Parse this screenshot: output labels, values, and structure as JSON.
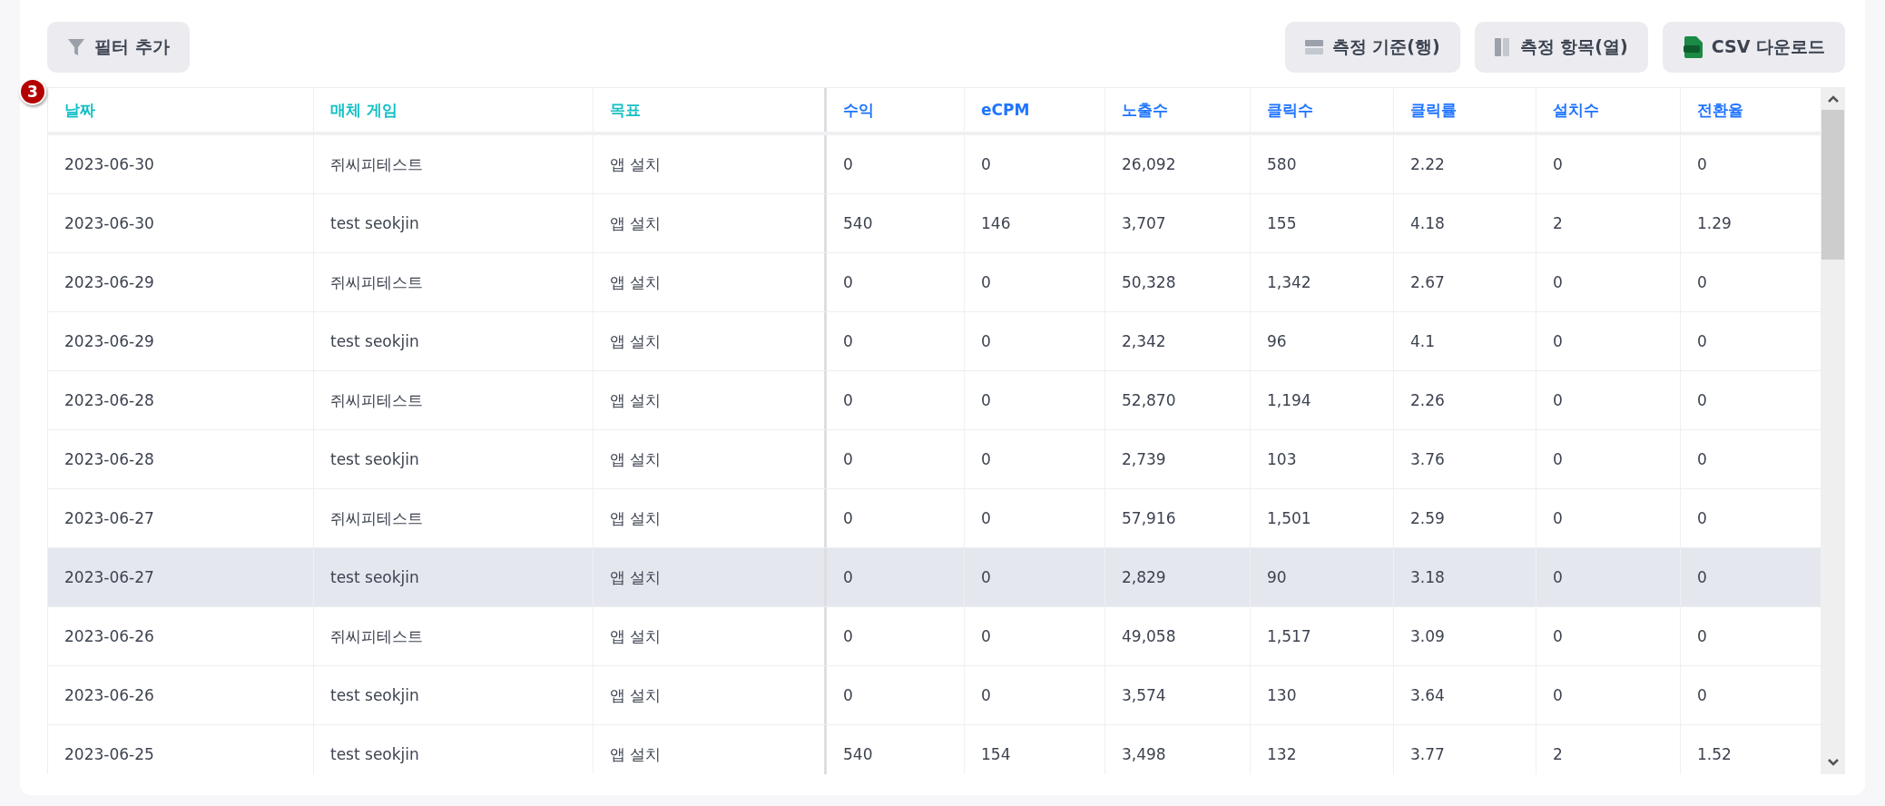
{
  "toolbar": {
    "filter_button": "필터 추가",
    "buttons": [
      {
        "kind": "rows",
        "label": "측정 기준(행)"
      },
      {
        "kind": "columns",
        "label": "측정 항목(열)"
      },
      {
        "kind": "csv",
        "label": "CSV 다운로드"
      }
    ]
  },
  "step_badge": "3",
  "table": {
    "columns": [
      {
        "label": "날짜",
        "kind": "dimension"
      },
      {
        "label": "매체 게임",
        "kind": "dimension"
      },
      {
        "label": "목표",
        "kind": "dimension"
      },
      {
        "label": "수익",
        "kind": "metric"
      },
      {
        "label": "eCPM",
        "kind": "metric"
      },
      {
        "label": "노출수",
        "kind": "metric"
      },
      {
        "label": "클릭수",
        "kind": "metric"
      },
      {
        "label": "클릭률",
        "kind": "metric"
      },
      {
        "label": "설치수",
        "kind": "metric"
      },
      {
        "label": "전환율",
        "kind": "metric"
      }
    ],
    "rows": [
      {
        "selected": false,
        "cells": [
          "2023-06-30",
          "쥐씨피테스트",
          "앱 설치",
          "0",
          "0",
          "26,092",
          "580",
          "2.22",
          "0",
          "0"
        ]
      },
      {
        "selected": false,
        "cells": [
          "2023-06-30",
          "test seokjin",
          "앱 설치",
          "540",
          "146",
          "3,707",
          "155",
          "4.18",
          "2",
          "1.29"
        ]
      },
      {
        "selected": false,
        "cells": [
          "2023-06-29",
          "쥐씨피테스트",
          "앱 설치",
          "0",
          "0",
          "50,328",
          "1,342",
          "2.67",
          "0",
          "0"
        ]
      },
      {
        "selected": false,
        "cells": [
          "2023-06-29",
          "test seokjin",
          "앱 설치",
          "0",
          "0",
          "2,342",
          "96",
          "4.1",
          "0",
          "0"
        ]
      },
      {
        "selected": false,
        "cells": [
          "2023-06-28",
          "쥐씨피테스트",
          "앱 설치",
          "0",
          "0",
          "52,870",
          "1,194",
          "2.26",
          "0",
          "0"
        ]
      },
      {
        "selected": false,
        "cells": [
          "2023-06-28",
          "test seokjin",
          "앱 설치",
          "0",
          "0",
          "2,739",
          "103",
          "3.76",
          "0",
          "0"
        ]
      },
      {
        "selected": false,
        "cells": [
          "2023-06-27",
          "쥐씨피테스트",
          "앱 설치",
          "0",
          "0",
          "57,916",
          "1,501",
          "2.59",
          "0",
          "0"
        ]
      },
      {
        "selected": true,
        "cells": [
          "2023-06-27",
          "test seokjin",
          "앱 설치",
          "0",
          "0",
          "2,829",
          "90",
          "3.18",
          "0",
          "0"
        ]
      },
      {
        "selected": false,
        "cells": [
          "2023-06-26",
          "쥐씨피테스트",
          "앱 설치",
          "0",
          "0",
          "49,058",
          "1,517",
          "3.09",
          "0",
          "0"
        ]
      },
      {
        "selected": false,
        "cells": [
          "2023-06-26",
          "test seokjin",
          "앱 설치",
          "0",
          "0",
          "3,574",
          "130",
          "3.64",
          "0",
          "0"
        ]
      },
      {
        "selected": false,
        "cells": [
          "2023-06-25",
          "test seokjin",
          "앱 설치",
          "540",
          "154",
          "3,498",
          "132",
          "3.77",
          "2",
          "1.52"
        ]
      }
    ]
  }
}
